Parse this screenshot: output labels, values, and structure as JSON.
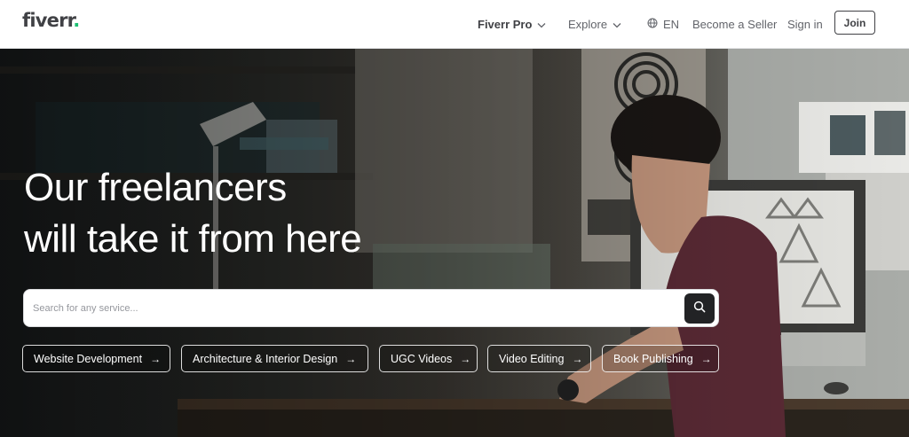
{
  "brand": {
    "logo_text": "fiverr",
    "logo_dot": ".",
    "accent_color": "#1dbf73"
  },
  "header": {
    "nav": {
      "fiverr_pro": "Fiverr Pro",
      "explore": "Explore",
      "language": "EN",
      "become_seller": "Become a Seller",
      "sign_in": "Sign in",
      "join": "Join"
    },
    "icons": {
      "chevron": "chevron-down-icon",
      "globe": "globe-icon"
    }
  },
  "hero": {
    "headline_line1": "Our freelancers",
    "headline_line2": "will take it from here",
    "search": {
      "placeholder": "Search for any service...",
      "value": "",
      "icon": "search-icon"
    },
    "categories": [
      {
        "label": "Website Development",
        "arrow": "→"
      },
      {
        "label": "Architecture & Interior Design",
        "arrow": "→"
      },
      {
        "label": "UGC Videos",
        "arrow": "→"
      },
      {
        "label": "Video Editing",
        "arrow": "→"
      },
      {
        "label": "Book Publishing",
        "arrow": "→"
      }
    ]
  }
}
